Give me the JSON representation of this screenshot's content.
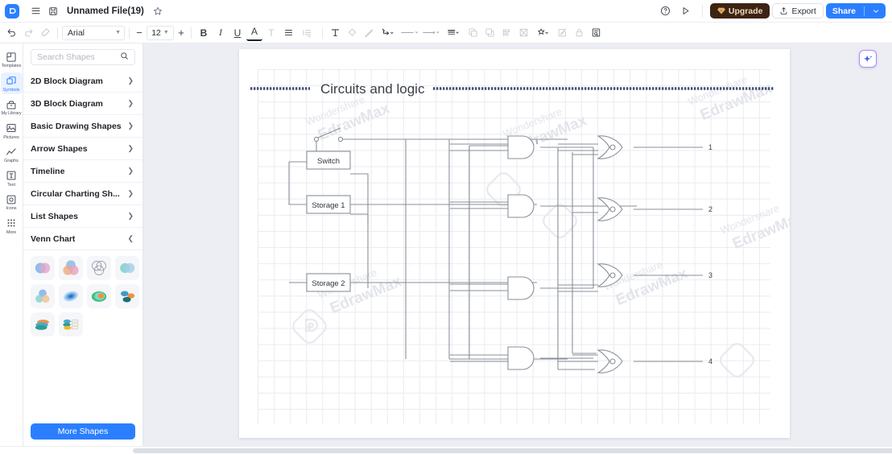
{
  "titlebar": {
    "logo_icon": "edraw-logo-icon",
    "menu_icon": "hamburger-menu-icon",
    "save_icon": "save-disk-icon",
    "filename": "Unnamed File(19)",
    "star_icon": "star-favorite-icon",
    "help_icon": "help-circle-icon",
    "present_icon": "play-present-icon",
    "upgrade_label": "Upgrade",
    "upgrade_icon": "gem-diamond-icon",
    "export_label": "Export",
    "export_icon": "export-upload-icon",
    "share_label": "Share",
    "share_caret": "chevron-down-icon"
  },
  "colors": {
    "accent_blue": "#2b7fff",
    "upgrade_bg": "#3c2415",
    "upgrade_text": "#f2d9b8",
    "panel_border": "#e4e6ec",
    "canvas_bg": "#eceef4",
    "grid_line": "#e9ebf0",
    "diagram_stroke": "#8a8f99",
    "title_dot_line": "#41506e"
  },
  "formatbar": {
    "undo_icon": "undo-arrow-icon",
    "redo_icon": "redo-arrow-icon",
    "format_painter_icon": "format-painter-icon",
    "font_family": "Arial",
    "font_size": "12",
    "decrease_label": "−",
    "increase_label": "+",
    "bold_label": "B",
    "italic_label": "I",
    "underline_label": "U",
    "font_color_label": "A",
    "strikethrough_label": "T",
    "align_icon": "align-left-icon",
    "line_spacing_icon": "line-spacing-icon",
    "text_box_icon": "text-box-icon",
    "fill_icon": "fill-color-icon",
    "line_style_icon": "pen-line-icon",
    "connector_icon": "connector-elbow-icon",
    "line_weight_icon": "line-weight-icon",
    "arrow_style_icon": "arrow-endpoint-icon",
    "dash_style_icon": "dash-style-icon",
    "front_icon": "bring-to-front-icon",
    "back_icon": "send-to-back-icon",
    "align_objects_icon": "align-objects-icon",
    "distribute_icon": "distribute-objects-icon",
    "theme_icon": "theme-color-icon",
    "edit_icon": "edit-pencil-icon",
    "lock_icon": "lock-closed-icon",
    "notes_icon": "notes-page-icon"
  },
  "rail": {
    "items": [
      {
        "label": "Templates",
        "icon": "templates-icon",
        "active": false
      },
      {
        "label": "Symbols",
        "icon": "symbols-icon",
        "active": true
      },
      {
        "label": "My Library",
        "icon": "my-library-icon",
        "active": false
      },
      {
        "label": "Pictures",
        "icon": "pictures-icon",
        "active": false
      },
      {
        "label": "Graphs",
        "icon": "graphs-icon",
        "active": false
      },
      {
        "label": "Text",
        "icon": "text-icon",
        "active": false
      },
      {
        "label": "Icons",
        "icon": "icons-icon",
        "active": false
      },
      {
        "label": "More",
        "icon": "more-grid-icon",
        "active": false
      }
    ]
  },
  "panel": {
    "search_placeholder": "Search Shapes",
    "search_value": "",
    "search_icon": "search-icon",
    "categories": [
      {
        "name": "2D Block Diagram",
        "expanded": false
      },
      {
        "name": "3D Block Diagram",
        "expanded": false
      },
      {
        "name": "Basic Drawing Shapes",
        "expanded": false
      },
      {
        "name": "Arrow Shapes",
        "expanded": false
      },
      {
        "name": "Timeline",
        "expanded": false
      },
      {
        "name": "Circular Charting Sh...",
        "expanded": false
      },
      {
        "name": "List Shapes",
        "expanded": false
      },
      {
        "name": "Venn Chart",
        "expanded": true
      }
    ],
    "venn_shapes": [
      "two-circle-venn",
      "three-circle-venn-filled",
      "three-circle-venn-outline",
      "two-circle-overlap-teal",
      "three-circle-cluster",
      "nested-circles",
      "concentric-green-orange",
      "three-ellipse-cluster",
      "stacked-ellipses",
      "ellipse-callout-list"
    ],
    "more_shapes_label": "More Shapes"
  },
  "canvas": {
    "ai_icon": "ai-sparkle-icon",
    "watermark_line1": "Wondershare",
    "watermark_line2": "EdrawMax",
    "diagram": {
      "title": "Circuits and logic",
      "blocks": [
        {
          "label": "Switch"
        },
        {
          "label": "Storage 1"
        },
        {
          "label": "Storage 2"
        }
      ],
      "switch_symbol": "open-switch-icon",
      "and_gates": 4,
      "nor_gates": 4,
      "output_labels": [
        "1",
        "2",
        "3",
        "4"
      ]
    }
  }
}
